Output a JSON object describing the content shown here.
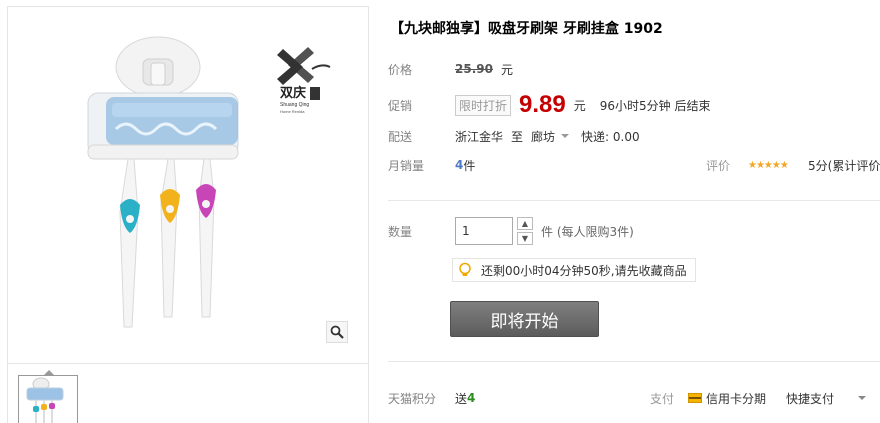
{
  "product": {
    "title": "【九块邮独享】吸盘牙刷架 牙刷挂盒 1902",
    "brand_logo_text": "双庆",
    "brand_logo_sub": "Shuang Qing",
    "brand_logo_tag": "Home Renida"
  },
  "price": {
    "label": "价格",
    "original": "25.90",
    "unit": "元"
  },
  "promotion": {
    "label": "促销",
    "tag": "限时打折",
    "price": "9.89",
    "unit": "元",
    "countdown": "96小时5分钟 后结束"
  },
  "delivery": {
    "label": "配送",
    "from": "浙江金华",
    "to_label": "至",
    "to": "廊坊",
    "fee": "快递: 0.00"
  },
  "sales": {
    "label": "月销量",
    "count": "4",
    "count_unit": "件",
    "rating_label": "评价",
    "stars": "★★★★★",
    "rating_text": "5分(累计评价"
  },
  "quantity": {
    "label": "数量",
    "value": "1",
    "up": "▲",
    "down": "▼",
    "note": "件 (每人限购3件)"
  },
  "tip": {
    "text": "还剩00小时04分钟50秒,请先收藏商品"
  },
  "buy_button": {
    "label": "即将开始"
  },
  "points": {
    "label": "天猫积分",
    "prefix": "送",
    "value": "4"
  },
  "payment": {
    "label": "支付",
    "card": "信用卡分期",
    "quick": "快捷支付"
  },
  "colors": {
    "promo_price": "#c40000",
    "points": "#2e8b1f",
    "sold": "#4c7ac4",
    "button": "#666666"
  },
  "icons": [
    "zoom-icon",
    "bulb-icon",
    "credit-card-icon",
    "chevron-down-icon"
  ]
}
